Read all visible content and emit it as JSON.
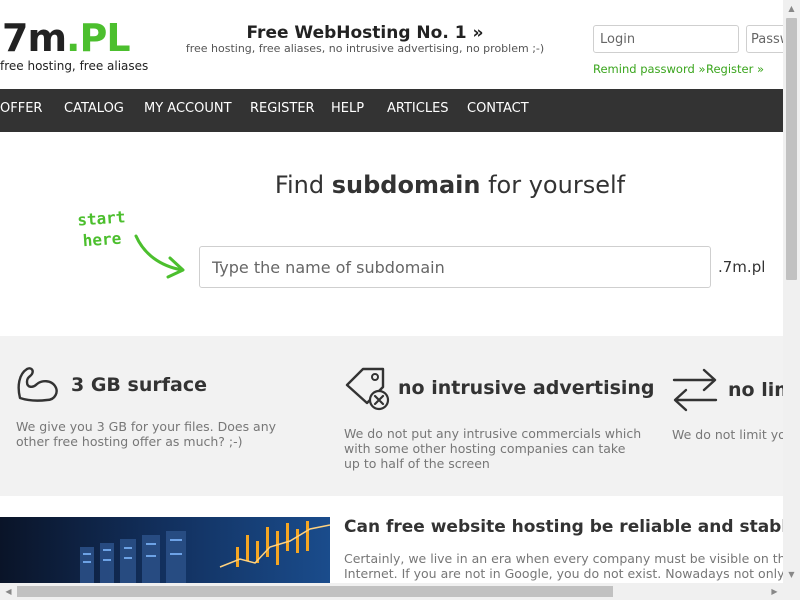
{
  "header": {
    "logo_main": "7m",
    "logo_accent": ".PL",
    "tagline": "free hosting, free aliases",
    "promo_title": "Free WebHosting No. 1 »",
    "promo_subtitle": "free hosting, free aliases, no intrusive advertising, no problem ;-)",
    "login_placeholder": "Login",
    "password_placeholder": "Password",
    "remind_password": "Remind password »",
    "register_link": "Register »"
  },
  "nav": {
    "items": [
      "OFFER",
      "CATALOG",
      "MY ACCOUNT",
      "REGISTER",
      "HELP",
      "ARTICLES",
      "CONTACT"
    ]
  },
  "search": {
    "title_pre": "Find ",
    "title_bold": "subdomain",
    "title_post": " for yourself",
    "hint_line1": "start",
    "hint_line2": "here",
    "placeholder": "Type the name of subdomain",
    "suffix": ".7m.pl"
  },
  "features": [
    {
      "icon": "bicep-icon",
      "title": "3 GB surface",
      "desc": "We give you 3 GB for your files. Does any other free hosting offer as much? ;-)"
    },
    {
      "icon": "no-ad-tag-icon",
      "title": "no intrusive advertising",
      "desc": "We do not put any intrusive commercials which with some other hosting companies can take up to half of the screen"
    },
    {
      "icon": "transfer-arrows-icon",
      "title": "no limit",
      "desc": "We do not limit your transfer"
    }
  ],
  "article": {
    "title": "Can free website hosting be reliable and stable?",
    "text": "Certainly, we live in an era when every company must be visible on the Internet. If you are not in Google, you do not exist. Nowadays not only business owners but also private persons create their own sites."
  },
  "colors": {
    "accent": "#4cbf2e",
    "link_green": "#3aa51d",
    "nav_bg": "#333333",
    "features_bg": "#f2f2f2"
  }
}
